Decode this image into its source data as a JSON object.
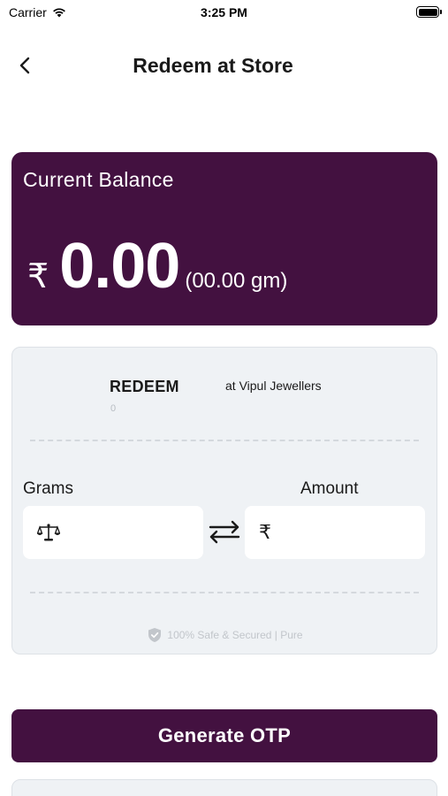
{
  "status_bar": {
    "carrier": "Carrier",
    "time": "3:25 PM"
  },
  "nav": {
    "title": "Redeem at Store"
  },
  "balance": {
    "label": "Current Balance",
    "currency_symbol": "₹",
    "amount": "0.00",
    "grams": "(00.00 gm)"
  },
  "redeem": {
    "title": "REDEEM",
    "store": "at Vipul Jewellers",
    "value": "0",
    "grams_label": "Grams",
    "amount_label": "Amount",
    "amount_prefix": "₹",
    "secure_text": "100% Safe & Secured | Pure"
  },
  "actions": {
    "generate_otp": "Generate OTP"
  },
  "icons": {
    "back": "chevron-left-icon",
    "scale": "scale-icon",
    "swap": "swap-arrows-icon",
    "shield": "shield-check-icon",
    "wifi": "wifi-icon",
    "battery": "battery-icon"
  },
  "colors": {
    "brand": "#431140",
    "card_bg": "#eff2f5",
    "muted": "#c2c6cb"
  }
}
